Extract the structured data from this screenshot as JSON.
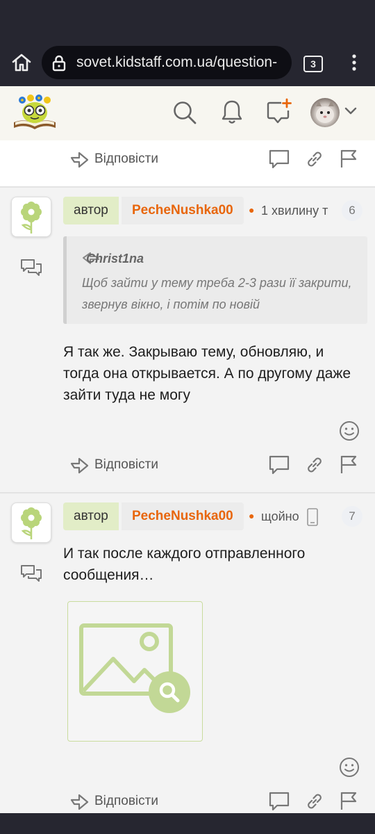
{
  "browser": {
    "url": "sovet.kidstaff.com.ua/question-",
    "tab_count": "3"
  },
  "actions": {
    "reply_label": "Відповісти"
  },
  "posts": [
    {
      "author_badge": "автор",
      "username": "PecheNushka00",
      "time": "1 хвилину т",
      "number": "6",
      "quote": {
        "author": "Christ1na",
        "text": "Щоб зайти у тему треба 2-3 рази її закрити, звернув вікно, і потім по новій"
      },
      "message": "Я так же. Закрываю тему, обновляю, и тогда она открывается. А по другому даже зайти туда не могу"
    },
    {
      "author_badge": "автор",
      "username": "PecheNushka00",
      "time": "щойно",
      "number": "7",
      "message": "И так после каждого отправленного сообщения…"
    }
  ],
  "colors": {
    "accent": "#e8660c",
    "author_badge_bg": "#e2edc7",
    "chrome_bg": "#262630"
  }
}
